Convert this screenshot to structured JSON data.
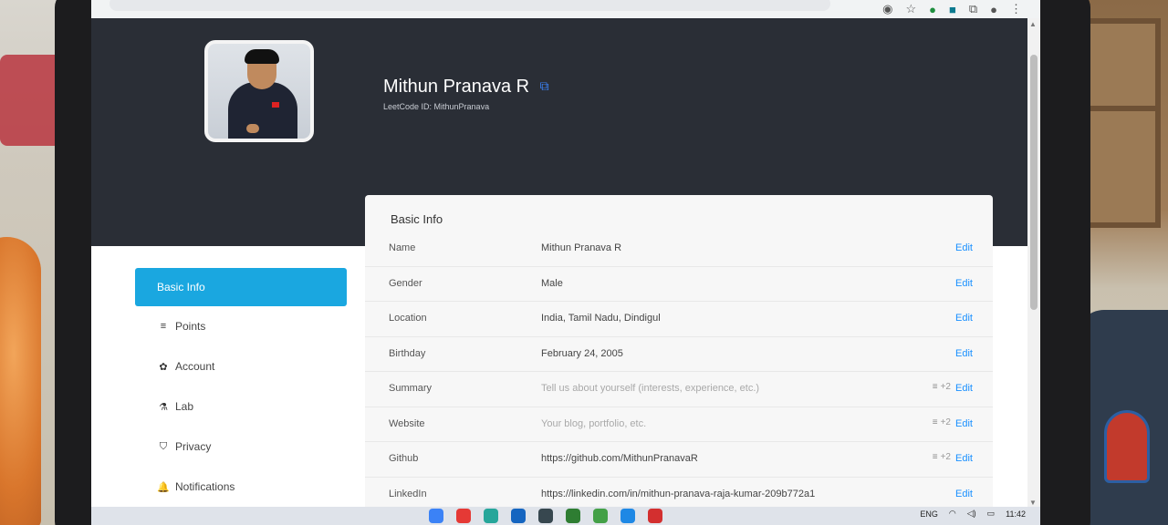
{
  "browser": {
    "toolbar_icons": [
      "eye-off-icon",
      "star-icon",
      "extension-icon",
      "extension-icon",
      "puzzle-icon",
      "profile-icon",
      "menu-dots-icon"
    ],
    "star": "☆",
    "menu": "⋮"
  },
  "profile": {
    "name": "Mithun Pranava R",
    "leetcode_id": "LeetCode ID: MithunPranava"
  },
  "sidebar": {
    "items": [
      {
        "label": "Basic Info",
        "icon": "",
        "active": true
      },
      {
        "label": "Points",
        "icon": "≡"
      },
      {
        "label": "Account",
        "icon": "✿"
      },
      {
        "label": "Lab",
        "icon": "⚗"
      },
      {
        "label": "Privacy",
        "icon": "⛉"
      },
      {
        "label": "Notifications",
        "icon": "🔔"
      }
    ]
  },
  "basic_info": {
    "title": "Basic Info",
    "edit_label": "Edit",
    "rows": [
      {
        "label": "Name",
        "value": "Mithun Pranava R"
      },
      {
        "label": "Gender",
        "value": "Male"
      },
      {
        "label": "Location",
        "value": "India, Tamil Nadu, Dindigul"
      },
      {
        "label": "Birthday",
        "value": "February 24, 2005"
      },
      {
        "label": "Summary",
        "placeholder": "Tell us about yourself (interests, experience, etc.)",
        "extra": "+2"
      },
      {
        "label": "Website",
        "placeholder": "Your blog, portfolio, etc.",
        "extra": "+2"
      },
      {
        "label": "Github",
        "value": "https://github.com/MithunPranavaR",
        "extra": "+2"
      },
      {
        "label": "LinkedIn",
        "value": "https://linkedin.com/in/mithun-pranava-raja-kumar-209b772a1"
      }
    ]
  },
  "taskbar": {
    "language": "ENG",
    "time": "11:42",
    "app_colors": [
      "#3b82f6",
      "#e53935",
      "#26a69a",
      "#1565c0",
      "#37474f",
      "#2e7d32",
      "#43a047",
      "#1e88e5",
      "#d32f2f"
    ]
  },
  "colors": {
    "accent": "#1aa7e0",
    "header_bg": "#2a2e36",
    "edit_link": "#1a90ff"
  }
}
